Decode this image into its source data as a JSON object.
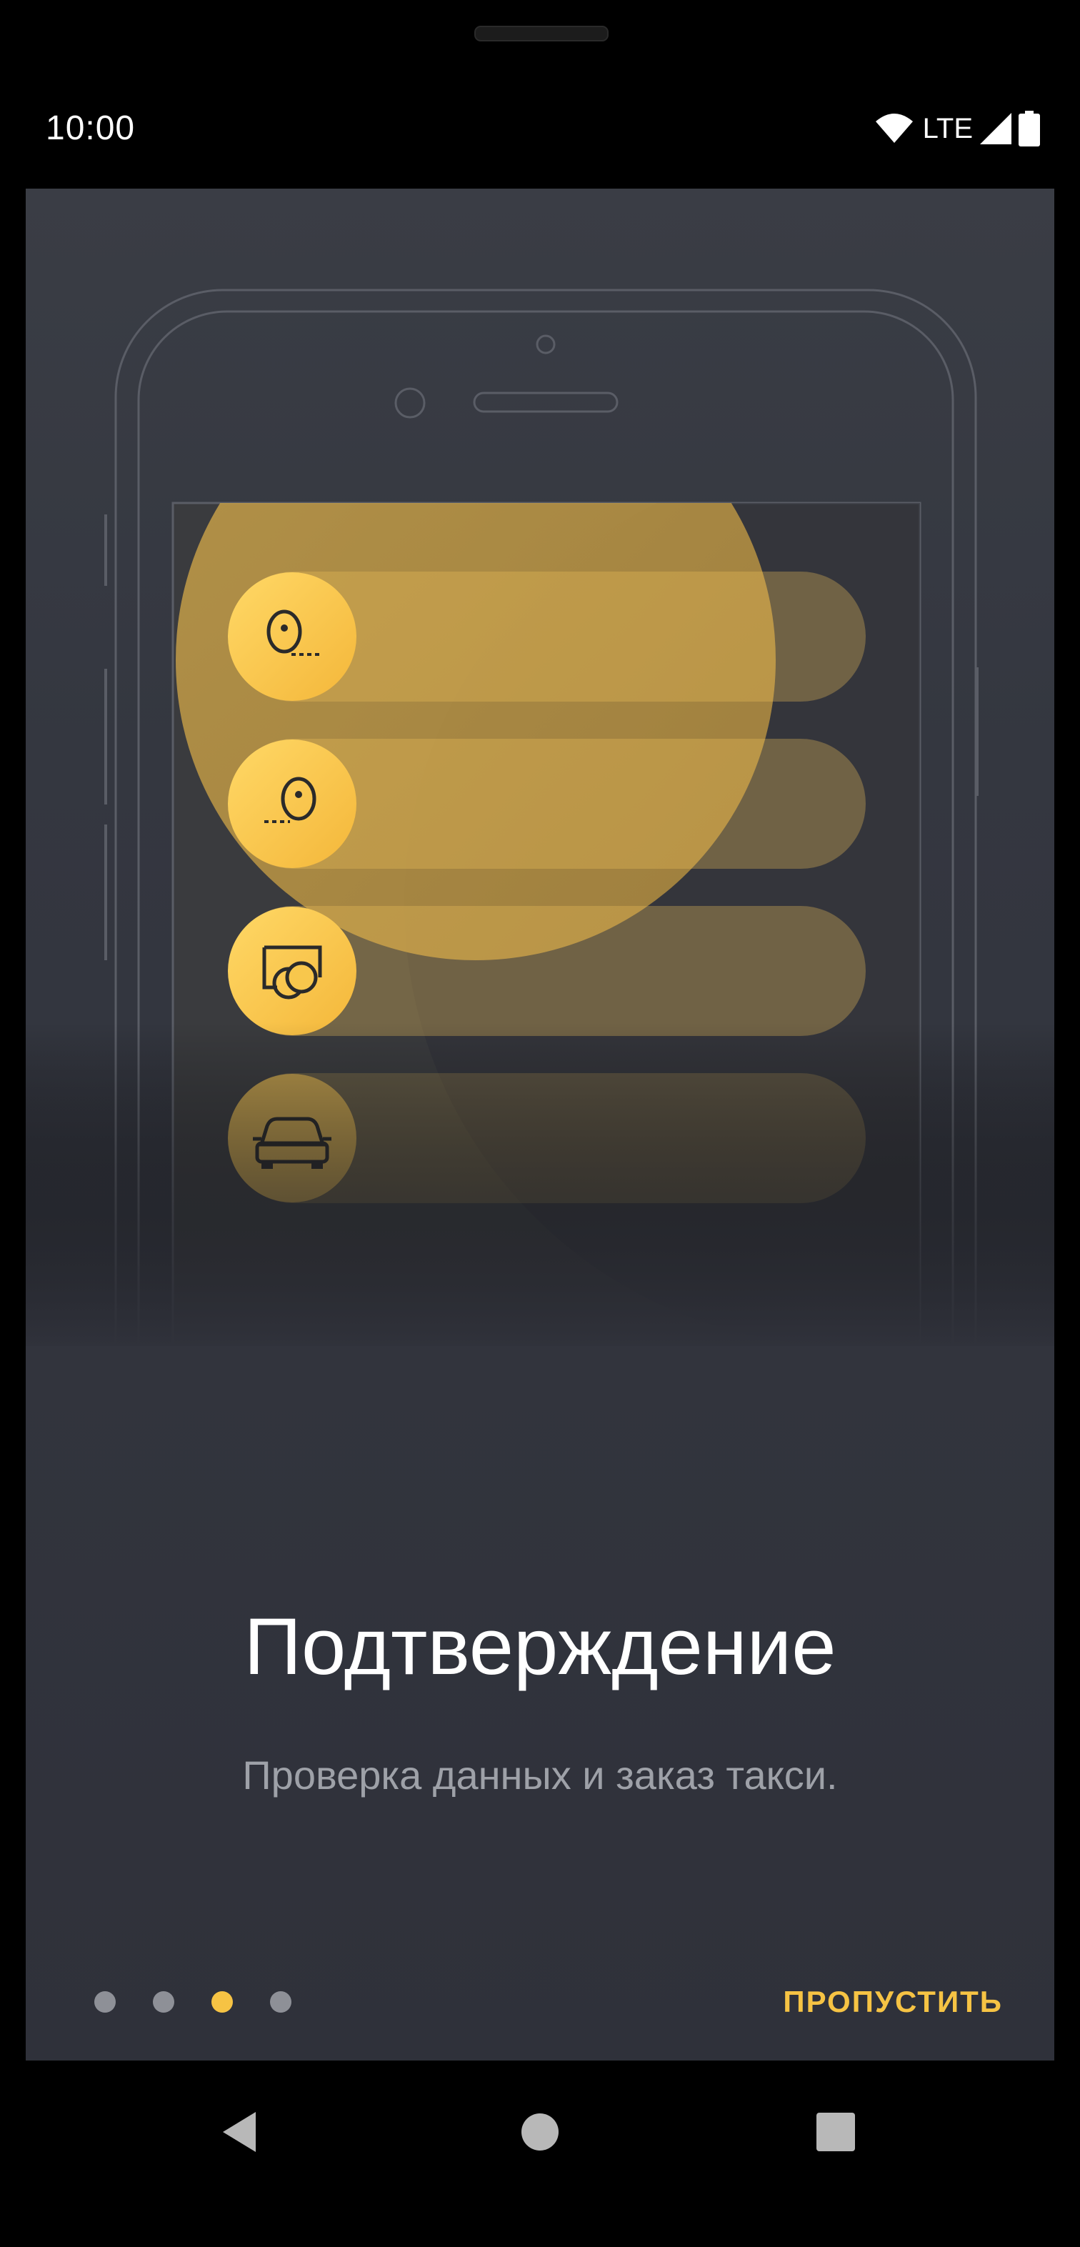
{
  "status_bar": {
    "time": "10:00",
    "network": "LTE",
    "icons": [
      "wifi-icon",
      "cell-signal-icon",
      "battery-icon"
    ]
  },
  "onboarding": {
    "title": "Подтверждение",
    "subtitle": "Проверка данных и заказ такси.",
    "steps": [
      {
        "icon": "pickup-point-icon"
      },
      {
        "icon": "destination-point-icon"
      },
      {
        "icon": "payment-card-icon"
      },
      {
        "icon": "car-icon"
      }
    ],
    "pager": {
      "count": 4,
      "active_index": 2
    },
    "skip_label": "ПРОПУСТИТЬ"
  },
  "navigation": {
    "buttons": [
      "back-icon",
      "home-icon",
      "recents-icon"
    ]
  },
  "colors": {
    "accent": "#f6c344",
    "background": "#32343c",
    "dot_inactive": "#8e9097",
    "subtitle": "#9ea1a8"
  }
}
